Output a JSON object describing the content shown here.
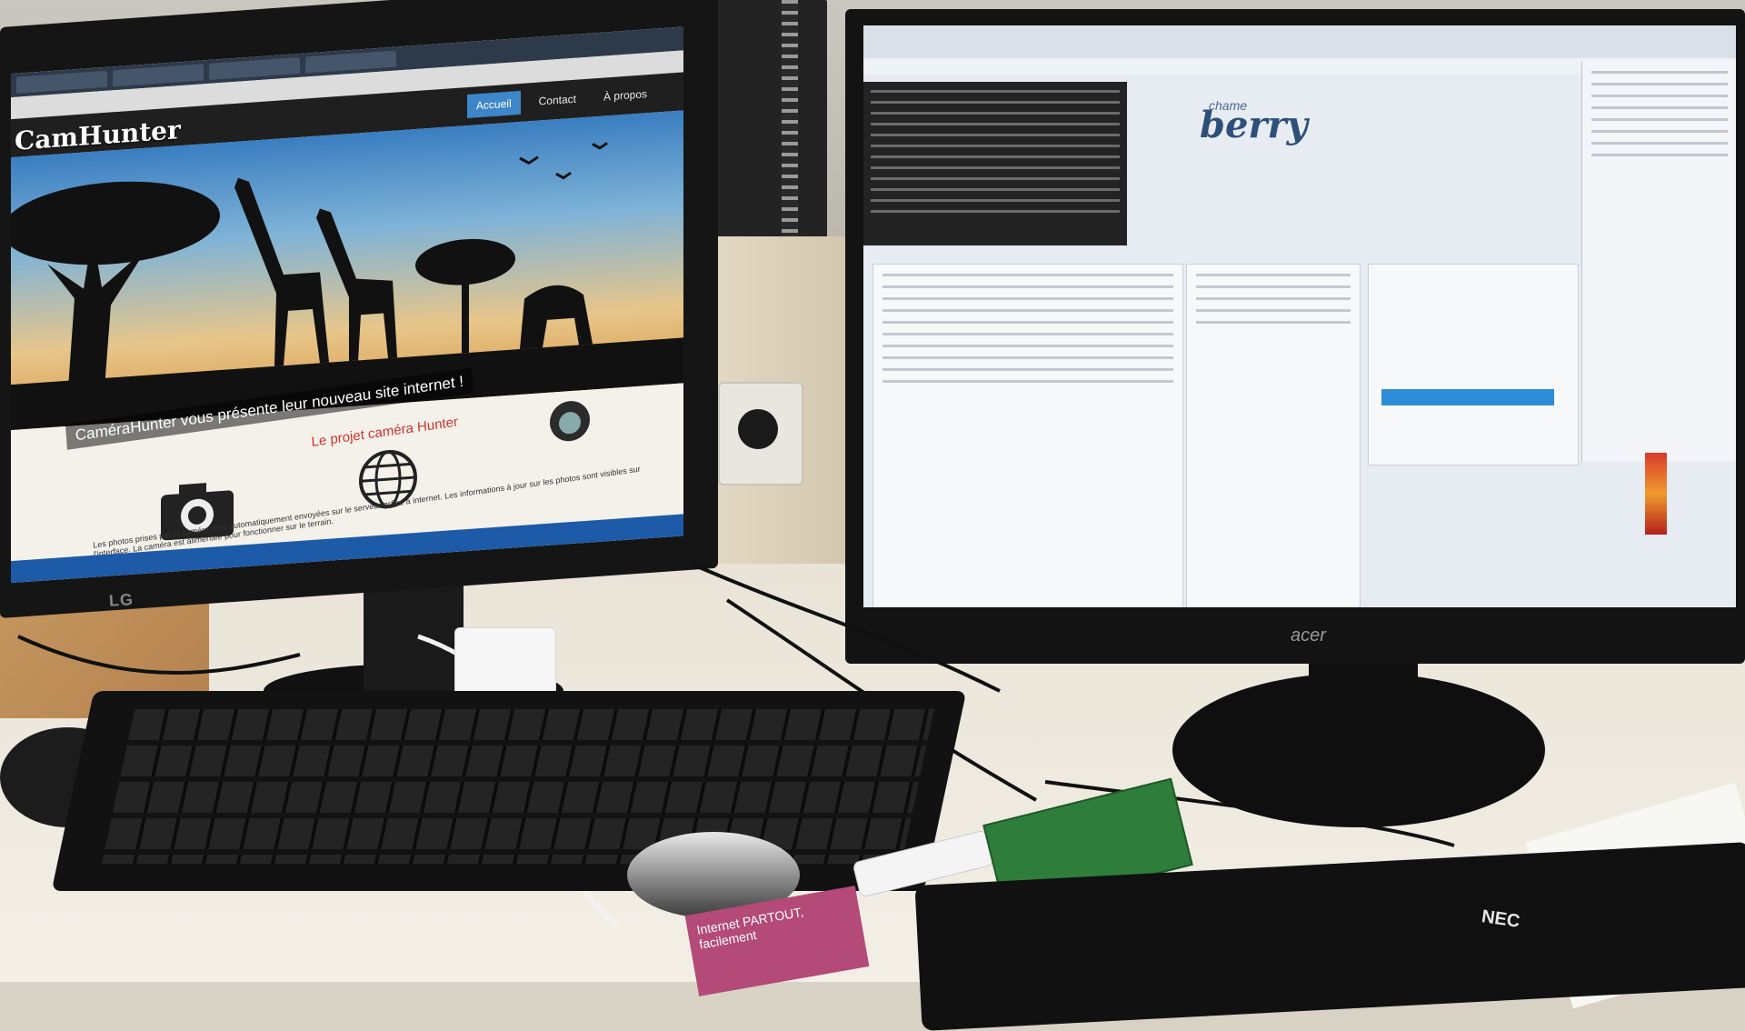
{
  "left_monitor": {
    "brand": "LG",
    "site": {
      "logo": "CamHunter",
      "logo_sub": "",
      "nav": [
        "Accueil",
        "Contact",
        "À propos"
      ],
      "caption": "CaméraHunter vous présente leur nouveau site internet !",
      "project_title": "Le projet caméra Hunter",
      "icons": [
        "camera-icon",
        "globe-icon",
        "animal-badge-icon"
      ],
      "description": "Les photos prises par la caméra sont automatiquement envoyées sur le serveur grâce à internet. Les informations à jour sur les photos sont visibles sur l'interface. La caméra est alimentée pour fonctionner sur le terrain."
    },
    "taskbar_apps": [
      "browser-icon",
      "folder-icon",
      "office-icon"
    ]
  },
  "right_monitor": {
    "brand": "acer",
    "app_logo_top": "chame",
    "app_logo_main": "berry",
    "panels": [
      "terminal",
      "code-editor",
      "file-list",
      "output-console"
    ]
  },
  "desk": {
    "keyboard_right_brand": "NEC",
    "card_text": "Internet PARTOUT, facilement"
  },
  "colors": {
    "nav_active": "#3d86c9",
    "project_title": "#d2322d",
    "berry_blue": "#2e4f7a",
    "selection_blue": "#2e8bd8"
  }
}
